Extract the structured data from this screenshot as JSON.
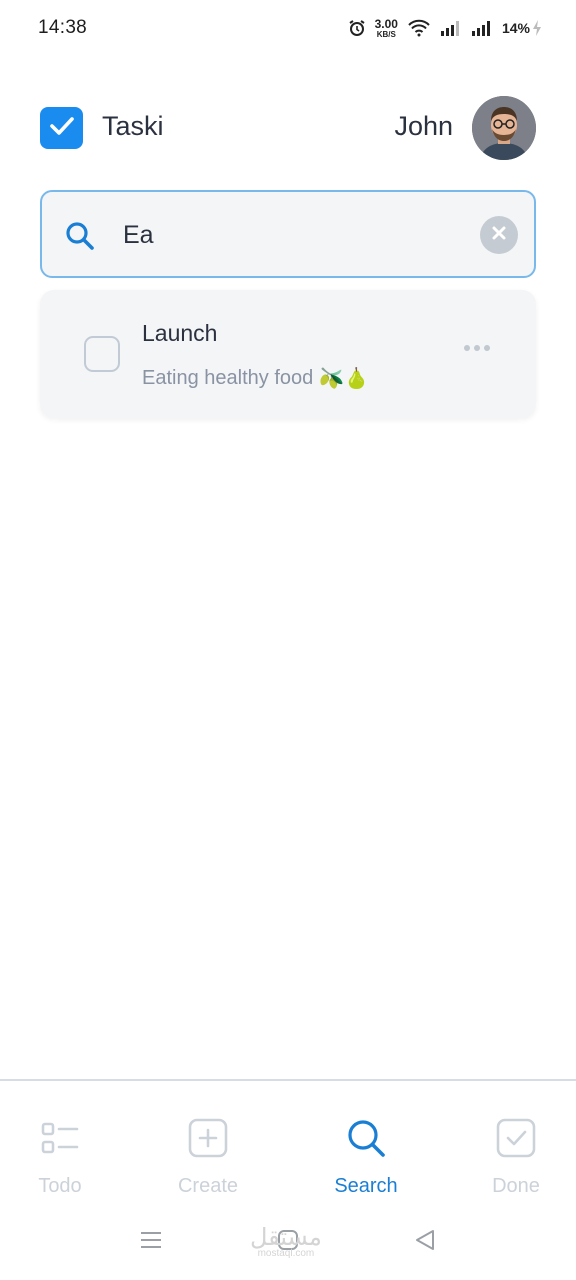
{
  "status_bar": {
    "time": "14:38",
    "net_speed_value": "3.00",
    "net_speed_unit": "KB/S",
    "battery": "14%",
    "icons": [
      "alarm-icon",
      "wifi-icon",
      "signal-icon",
      "signal-icon",
      "charging-icon"
    ]
  },
  "header": {
    "app_name": "Taski",
    "user_name": "John",
    "logo_icon": "check-icon",
    "accent_color": "#1a8cf0"
  },
  "search": {
    "value": "Ea",
    "icon": "search-icon",
    "clear_icon": "close-icon"
  },
  "tasks": [
    {
      "title": "Launch",
      "description": "Eating healthy food",
      "emojis": "🫒🍐",
      "done": false
    }
  ],
  "bottom_nav": {
    "items": [
      {
        "label": "Todo",
        "icon": "list-icon",
        "active": false
      },
      {
        "label": "Create",
        "icon": "plus-square-icon",
        "active": false
      },
      {
        "label": "Search",
        "icon": "search-icon",
        "active": true
      },
      {
        "label": "Done",
        "icon": "check-square-icon",
        "active": false
      }
    ],
    "active_color": "#1a7fd4",
    "inactive_color": "#ccd2d9"
  },
  "watermark": {
    "arabic": "مستقل",
    "latin": "mostaql.com"
  }
}
